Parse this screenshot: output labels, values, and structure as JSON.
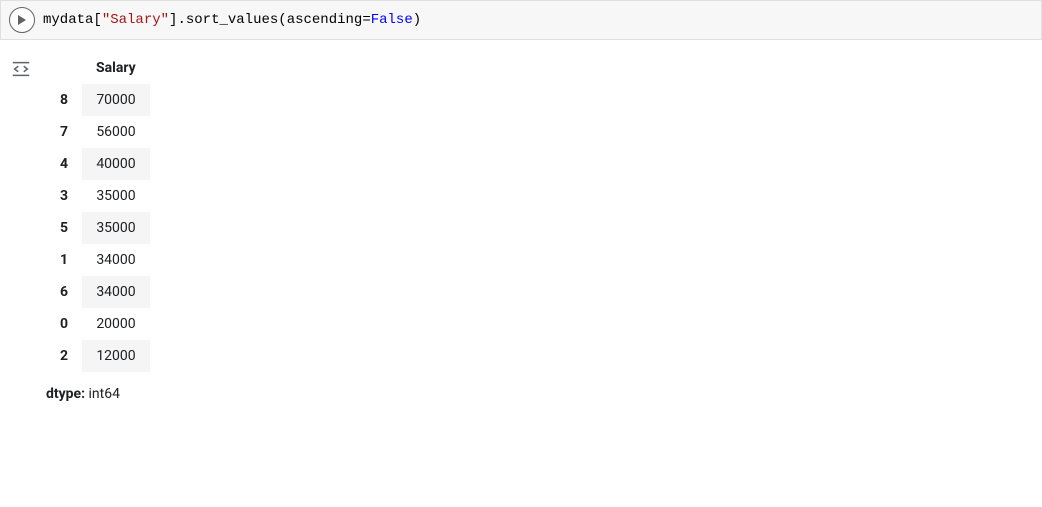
{
  "cell": {
    "code": {
      "variable": "mydata",
      "open_bracket": "[",
      "column_str": "\"Salary\"",
      "close_bracket": "]",
      "dot": ".",
      "method": "sort_values",
      "open_paren": "(",
      "kwarg_name": "ascending",
      "eq": "=",
      "kwarg_value": "False",
      "close_paren": ")"
    }
  },
  "output": {
    "column_header": "Salary",
    "rows": [
      {
        "index": "8",
        "value": "70000"
      },
      {
        "index": "7",
        "value": "56000"
      },
      {
        "index": "4",
        "value": "40000"
      },
      {
        "index": "3",
        "value": "35000"
      },
      {
        "index": "5",
        "value": "35000"
      },
      {
        "index": "1",
        "value": "34000"
      },
      {
        "index": "6",
        "value": "34000"
      },
      {
        "index": "0",
        "value": "20000"
      },
      {
        "index": "2",
        "value": "12000"
      }
    ],
    "dtype_label": "dtype:",
    "dtype_value": "int64"
  }
}
